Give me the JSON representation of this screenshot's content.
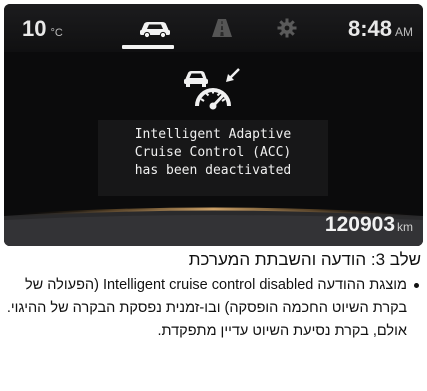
{
  "status_bar": {
    "temperature": "10",
    "temperature_unit": "°C",
    "time": "8:48",
    "time_period": "AM",
    "tabs": [
      {
        "icon": "car-icon",
        "active": true
      },
      {
        "icon": "road-lanes-icon",
        "active": false
      },
      {
        "icon": "gear-icon",
        "active": false
      }
    ]
  },
  "message": {
    "icon": "adaptive-cruise-control-icon",
    "lines": [
      "Intelligent Adaptive",
      "Cruise Control (ACC)",
      "has been deactivated"
    ]
  },
  "odometer": {
    "value": "120903",
    "unit": "km"
  },
  "caption": {
    "step_title": "שלב 3: הודעה והשבתת המערכת",
    "bullet_prefix": "מוצגת ההודעה",
    "bullet_english": "Intelligent cruise control disabled",
    "bullet_rest": "(הפעולה של בקרת השיוט החכמה הופסקה) ובו-זמנית נפסקת הבקרה של ההיגוי. אולם, בקרת נסיעת השיוט עדיין מתפקדת."
  },
  "colors": {
    "display_bg": "#0b0b0c",
    "display_text": "#f0f0f0",
    "accent_glow": "#e0b070"
  }
}
